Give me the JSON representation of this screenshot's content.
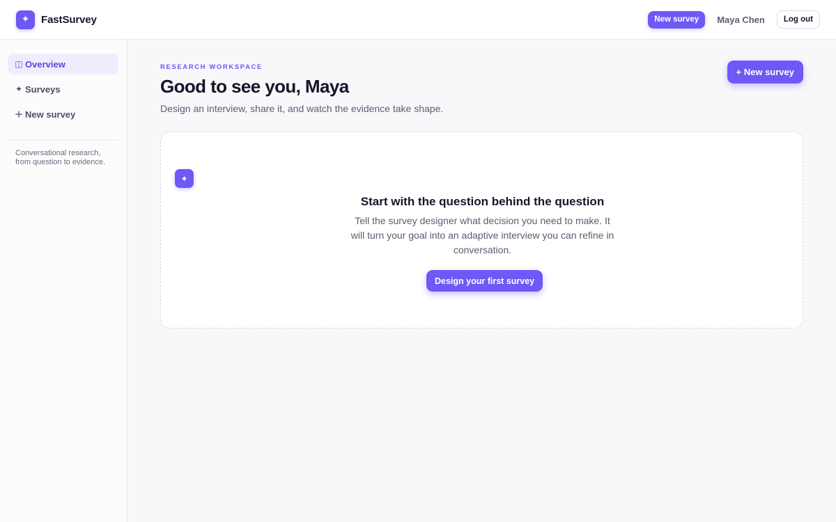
{
  "app": {
    "name": "FastSurvey",
    "logo_icon": "✦"
  },
  "header": {
    "new_survey_label": "New survey",
    "user_name": "Maya Chen",
    "logout_label": "Log out"
  },
  "sidebar": {
    "items": [
      {
        "icon": "◫",
        "icon_name": "columns-icon",
        "label": "Overview",
        "active": true
      },
      {
        "icon": "✦",
        "icon_name": "sparkle-icon",
        "label": "Surveys",
        "active": false
      },
      {
        "icon": "+",
        "icon_name": "plus-icon",
        "label": "New survey",
        "active": false
      }
    ],
    "tagline": "Conversational research, from question to evidence."
  },
  "main": {
    "eyebrow": "RESEARCH WORKSPACE",
    "title": "Good to see you, Maya",
    "subtitle": "Design an interview, share it, and watch the evidence take shape.",
    "new_survey_button": "+ New survey",
    "empty_state": {
      "badge_icon": "✦",
      "title": "Start with the question behind the question",
      "text": "Tell the survey designer what decision you need to make. It will turn your goal into an adaptive interview you can refine in conversation.",
      "cta_label": "Design your first survey"
    }
  },
  "colors": {
    "accent": "#6e58f6",
    "background": "#f8f8fb",
    "text": "#151528",
    "muted": "#5c5c70"
  }
}
